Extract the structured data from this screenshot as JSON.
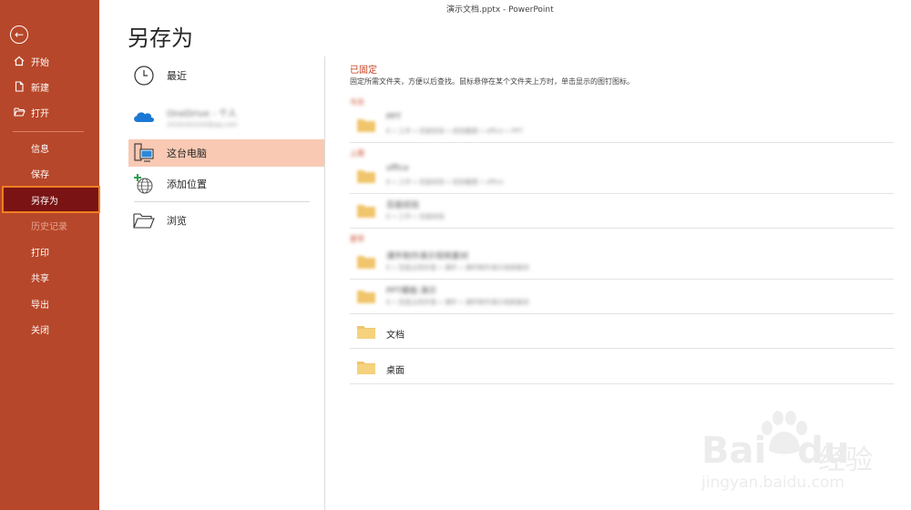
{
  "window": {
    "title": "演示文档.pptx  -  PowerPoint"
  },
  "sidebar": {
    "back_icon": "back-arrow-icon",
    "items": [
      {
        "label": "开始",
        "icon": "home-icon"
      },
      {
        "label": "新建",
        "icon": "new-file-icon"
      },
      {
        "label": "打开",
        "icon": "open-folder-icon"
      },
      {
        "label": "信息"
      },
      {
        "label": "保存"
      },
      {
        "label": "另存为",
        "active": true
      },
      {
        "label": "历史记录",
        "disabled": true
      },
      {
        "label": "打印"
      },
      {
        "label": "共享"
      },
      {
        "label": "导出"
      },
      {
        "label": "关闭"
      }
    ],
    "colors": {
      "background": "#b7472a",
      "active": "#7a1414",
      "active_border": "#f07f23"
    }
  },
  "main": {
    "title": "另存为",
    "locations": [
      {
        "label": "最近",
        "icon": "clock-icon"
      },
      {
        "label": "OneDrive - 个人",
        "sublabel": "2016163100@qq.com",
        "icon": "onedrive-cloud-icon",
        "blurred": true
      },
      {
        "label": "这台电脑",
        "icon": "this-pc-icon",
        "selected": true
      },
      {
        "label": "添加位置",
        "icon": "add-location-globe-icon"
      },
      {
        "label": "浏览",
        "icon": "open-folder-icon"
      }
    ]
  },
  "pinned": {
    "title": "已固定",
    "description": "固定所需文件夹，方便以后查找。鼠标悬停在某个文件夹上方时，单击显示的图钉图标。",
    "sections": [
      {
        "label": "今天",
        "folders": [
          {
            "name": "PPT",
            "path": "E » 工作 » 百度经验 » 经验截图 » office » PPT"
          }
        ]
      },
      {
        "label": "上周",
        "folders": [
          {
            "name": "office",
            "path": "E » 工作 » 百度经验 » 经验截图 » office"
          },
          {
            "name": "百度经验",
            "path": "E » 工作 » 百度经验"
          }
        ]
      },
      {
        "label": "更早",
        "folders": [
          {
            "name": "课件制作演示视频素材",
            "path": "E » 百度云同步盘 » 课件 » 课件制作演示视频素材"
          },
          {
            "name": "PPT模板·演示",
            "path": "E » 百度云同步盘 » 课件 » 课件制作演示视频素材"
          }
        ]
      }
    ],
    "standard_folders": [
      {
        "name": "文档"
      },
      {
        "name": "桌面"
      }
    ],
    "folder_color": "#f0c56c"
  },
  "watermark": {
    "brand": "Bai",
    "brand2": "du",
    "cn": "经验",
    "url": "jingyan.baidu.com"
  }
}
